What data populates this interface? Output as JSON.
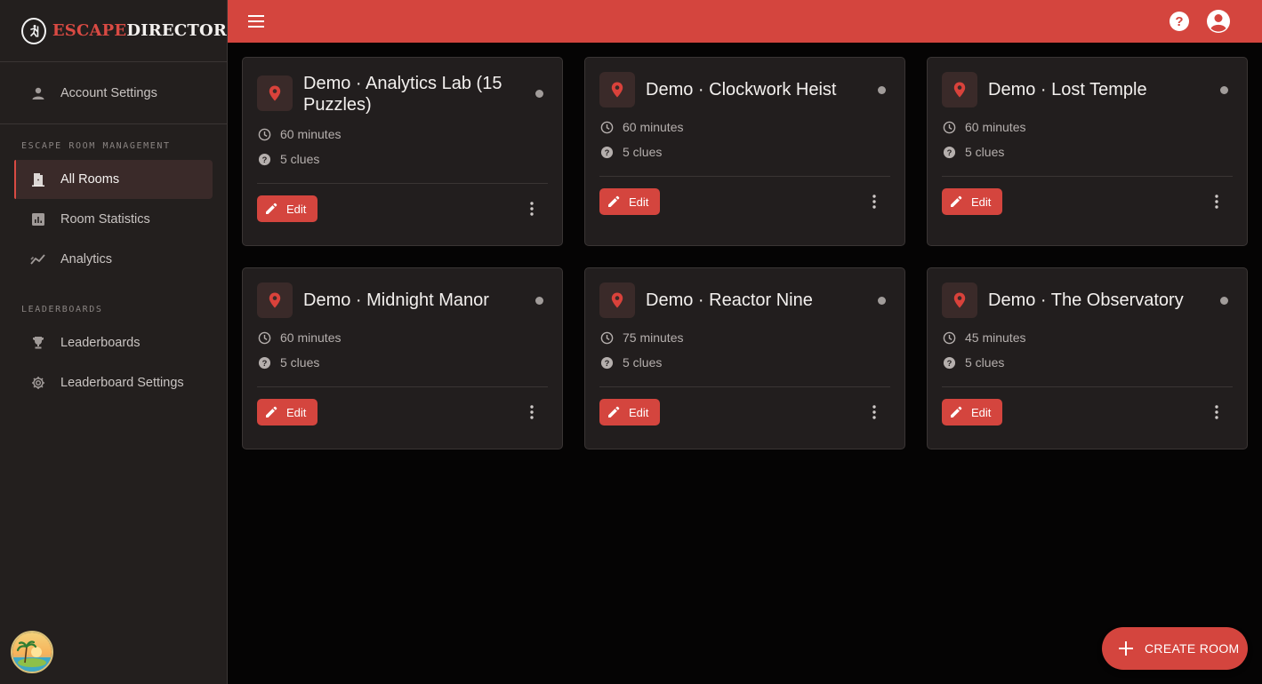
{
  "brand": {
    "part1": "ESCAPE",
    "part2": "DIRECTOR"
  },
  "sidebar": {
    "account_settings": {
      "label": "Account Settings",
      "icon": "person-icon"
    },
    "section_management": "ESCAPE ROOM MANAGEMENT",
    "section_leaderboards": "LEADERBOARDS",
    "items_management": [
      {
        "label": "All Rooms",
        "icon": "door-icon",
        "active": true
      },
      {
        "label": "Room Statistics",
        "icon": "bar-chart-icon",
        "active": false
      },
      {
        "label": "Analytics",
        "icon": "trend-icon",
        "active": false
      }
    ],
    "items_leaderboards": [
      {
        "label": "Leaderboards",
        "icon": "trophy-icon",
        "active": false
      },
      {
        "label": "Leaderboard Settings",
        "icon": "gear-icon",
        "active": false
      }
    ]
  },
  "header": {
    "menu_icon": "hamburger-icon",
    "help_icon": "help-icon",
    "account_icon": "account-circle-icon"
  },
  "rooms": [
    {
      "title": "Demo · Analytics Lab (15 Puzzles)",
      "duration": "60 minutes",
      "clues": "5 clues",
      "edit_label": "Edit",
      "status": "inactive"
    },
    {
      "title": "Demo · Clockwork Heist",
      "duration": "60 minutes",
      "clues": "5 clues",
      "edit_label": "Edit",
      "status": "inactive"
    },
    {
      "title": "Demo · Lost Temple",
      "duration": "60 minutes",
      "clues": "5 clues",
      "edit_label": "Edit",
      "status": "inactive"
    },
    {
      "title": "Demo · Midnight Manor",
      "duration": "60 minutes",
      "clues": "5 clues",
      "edit_label": "Edit",
      "status": "inactive"
    },
    {
      "title": "Demo · Reactor Nine",
      "duration": "75 minutes",
      "clues": "5 clues",
      "edit_label": "Edit",
      "status": "inactive"
    },
    {
      "title": "Demo · The Observatory",
      "duration": "45 minutes",
      "clues": "5 clues",
      "edit_label": "Edit",
      "status": "inactive"
    }
  ],
  "fab": {
    "label": "CREATE ROOM",
    "icon": "plus-icon"
  },
  "colors": {
    "accent": "#d4453e",
    "sidebar_bg": "#231f1e",
    "card_bg": "#221e1e",
    "page_bg": "#050404"
  }
}
